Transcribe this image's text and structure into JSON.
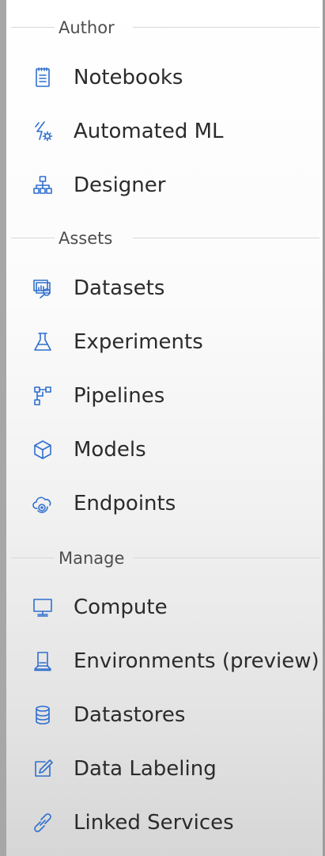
{
  "sections": {
    "author": {
      "label": "Author",
      "items": [
        {
          "label": "Notebooks",
          "icon": "notebook-icon"
        },
        {
          "label": "Automated ML",
          "icon": "automated-ml-icon"
        },
        {
          "label": "Designer",
          "icon": "designer-icon"
        }
      ]
    },
    "assets": {
      "label": "Assets",
      "items": [
        {
          "label": "Datasets",
          "icon": "datasets-icon"
        },
        {
          "label": "Experiments",
          "icon": "flask-icon"
        },
        {
          "label": "Pipelines",
          "icon": "pipelines-icon"
        },
        {
          "label": "Models",
          "icon": "cube-icon"
        },
        {
          "label": "Endpoints",
          "icon": "cloud-endpoint-icon"
        }
      ]
    },
    "manage": {
      "label": "Manage",
      "items": [
        {
          "label": "Compute",
          "icon": "monitor-icon"
        },
        {
          "label": "Environments (preview)",
          "icon": "environment-icon"
        },
        {
          "label": "Datastores",
          "icon": "database-icon"
        },
        {
          "label": "Data Labeling",
          "icon": "edit-icon"
        },
        {
          "label": "Linked Services",
          "icon": "link-icon"
        }
      ]
    }
  },
  "colors": {
    "icon": "#2f6fcf",
    "text": "#2b2b2b",
    "section_label": "#4e4e4e"
  }
}
